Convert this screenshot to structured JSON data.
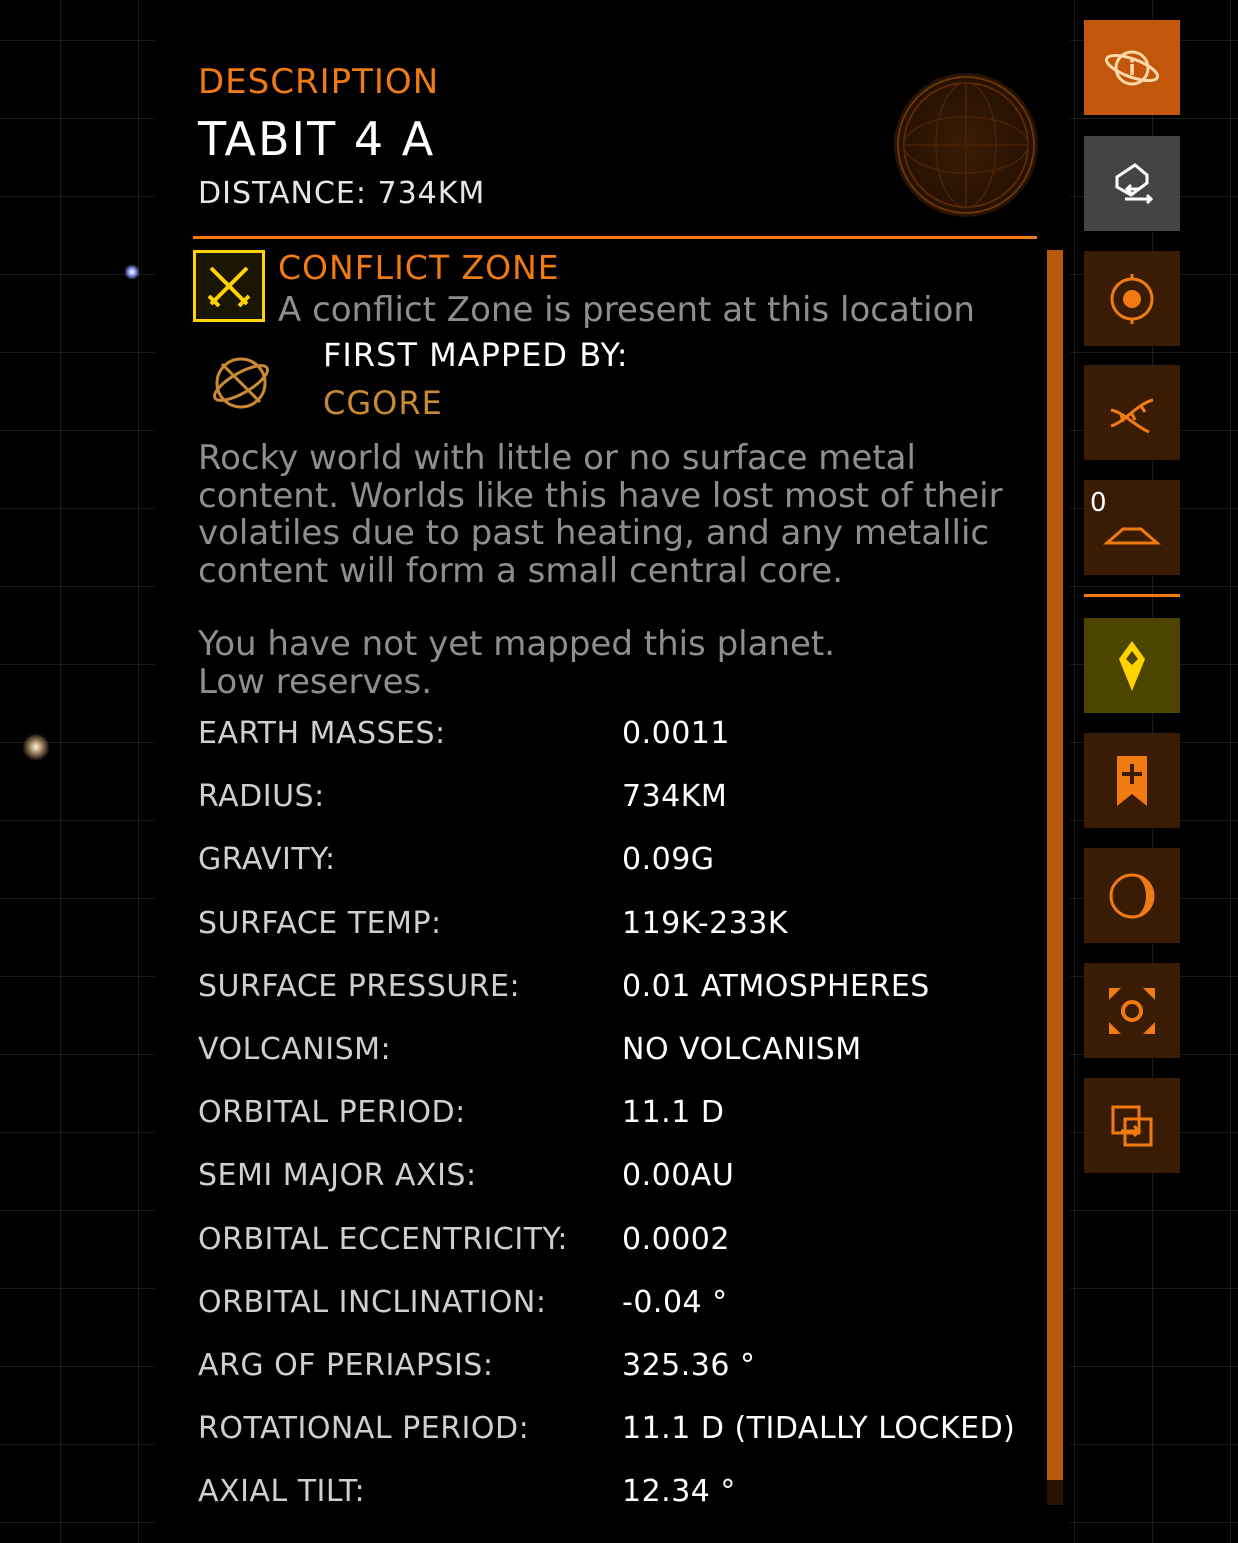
{
  "header": {
    "section_label": "DESCRIPTION",
    "body_name": "TABIT 4 A",
    "distance": "DISTANCE: 734KM"
  },
  "conflict": {
    "title": "CONFLICT ZONE",
    "description": "A conflict Zone is present at this location"
  },
  "first_mapped": {
    "label": "FIRST MAPPED BY:",
    "name": "CGORE"
  },
  "description": "Rocky world with little or no surface metal content. Worlds like this have lost most of their volatiles due to past heating, and any metallic content will form a small central core.",
  "status_lines": [
    "You have not yet mapped this planet.",
    "Low reserves."
  ],
  "stats": [
    {
      "label": "EARTH MASSES:",
      "value": "0.0011"
    },
    {
      "label": "RADIUS:",
      "value": "734KM"
    },
    {
      "label": "GRAVITY:",
      "value": "0.09G"
    },
    {
      "label": "SURFACE TEMP:",
      "value": "119K-233K"
    },
    {
      "label": "SURFACE PRESSURE:",
      "value": "0.01 ATMOSPHERES"
    },
    {
      "label": "VOLCANISM:",
      "value": "NO VOLCANISM"
    },
    {
      "label": "ORBITAL PERIOD:",
      "value": "11.1 D"
    },
    {
      "label": "SEMI MAJOR AXIS:",
      "value": "0.00AU"
    },
    {
      "label": "ORBITAL ECCENTRICITY:",
      "value": "0.0002"
    },
    {
      "label": "ORBITAL INCLINATION:",
      "value": "-0.04 °"
    },
    {
      "label": "ARG OF PERIAPSIS:",
      "value": "325.36 °"
    },
    {
      "label": "ROTATIONAL PERIOD:",
      "value": "11.1 D (TIDALLY LOCKED)"
    },
    {
      "label": "AXIAL TILT:",
      "value": "12.34 °"
    }
  ],
  "sidebar": {
    "surface_count": "0",
    "icons": [
      "planet-info-icon",
      "route-swap-icon",
      "target-body-icon",
      "biology-icon",
      "surface-signals-icon",
      "map-marker-icon",
      "add-bookmark-icon",
      "moon-view-icon",
      "focus-icon",
      "exit-view-icon"
    ]
  },
  "colors": {
    "accent_orange": "#f07b12",
    "highlight_yellow": "#ffd200",
    "mapper_gold": "#c98a35"
  }
}
